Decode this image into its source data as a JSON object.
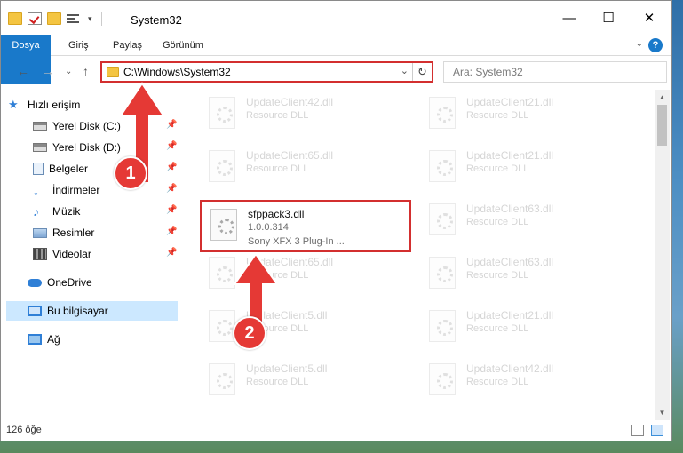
{
  "window": {
    "title": "System32",
    "minimize_glyph": "—",
    "maximize_glyph": "☐",
    "close_glyph": "✕"
  },
  "ribbon": {
    "tabs": [
      "Dosya",
      "Giriş",
      "Paylaş",
      "Görünüm"
    ],
    "help": "?",
    "collapse_glyph": "⌄"
  },
  "nav_buttons": {
    "back": "←",
    "forward": "→",
    "recent": "⌄",
    "up": "↑"
  },
  "address": {
    "path": "C:\\Windows\\System32",
    "dropdown": "⌄",
    "refresh": "↻"
  },
  "search": {
    "placeholder": "Ara: System32"
  },
  "sidebar": {
    "items": [
      {
        "label": "Hızlı erişim",
        "icon": "star-icon",
        "pinned": false
      },
      {
        "label": "Yerel Disk (C:)",
        "icon": "drive-icon",
        "pinned": true
      },
      {
        "label": "Yerel Disk (D:)",
        "icon": "drive-icon",
        "pinned": true
      },
      {
        "label": "Belgeler",
        "icon": "documents-icon",
        "pinned": true
      },
      {
        "label": "İndirmeler",
        "icon": "download-icon",
        "pinned": true
      },
      {
        "label": "Müzik",
        "icon": "music-icon",
        "pinned": true
      },
      {
        "label": "Resimler",
        "icon": "pictures-icon",
        "pinned": true
      },
      {
        "label": "Videolar",
        "icon": "video-icon",
        "pinned": true
      },
      {
        "label": "OneDrive",
        "icon": "cloud-icon",
        "pinned": false
      },
      {
        "label": "Bu bilgisayar",
        "icon": "computer-icon",
        "pinned": false
      },
      {
        "label": "Ağ",
        "icon": "network-icon",
        "pinned": false
      }
    ],
    "pin_glyph": "📌"
  },
  "files": [
    {
      "name": "UpdateClient42.dll",
      "type": "Resource DLL",
      "extra": ""
    },
    {
      "name": "UpdateClient21.dll",
      "type": "Resource DLL",
      "extra": ""
    },
    {
      "name": "UpdateClient65.dll",
      "type": "Resource DLL",
      "extra": ""
    },
    {
      "name": "UpdateClient21.dll",
      "type": "Resource DLL",
      "extra": ""
    },
    {
      "name": "sfppack3.dll",
      "type": "1.0.0.314",
      "extra": "Sony XFX 3 Plug-In ..."
    },
    {
      "name": "UpdateClient63.dll",
      "type": "Resource DLL",
      "extra": ""
    },
    {
      "name": "UpdateClient65.dll",
      "type": "Resource DLL",
      "extra": ""
    },
    {
      "name": "UpdateClient63.dll",
      "type": "Resource DLL",
      "extra": ""
    },
    {
      "name": "UpdateClient5.dll",
      "type": "Resource DLL",
      "extra": ""
    },
    {
      "name": "UpdateClient21.dll",
      "type": "Resource DLL",
      "extra": ""
    },
    {
      "name": "UpdateClient5.dll",
      "type": "Resource DLL",
      "extra": ""
    },
    {
      "name": "UpdateClient42.dll",
      "type": "Resource DLL",
      "extra": ""
    }
  ],
  "status": {
    "count": "126 öğe"
  },
  "annotations": {
    "badge1": "1",
    "badge2": "2"
  },
  "colors": {
    "accent": "#1979ca",
    "highlight": "#d32f2f",
    "annotation": "#e53935",
    "selected_bg": "#cce8ff"
  }
}
